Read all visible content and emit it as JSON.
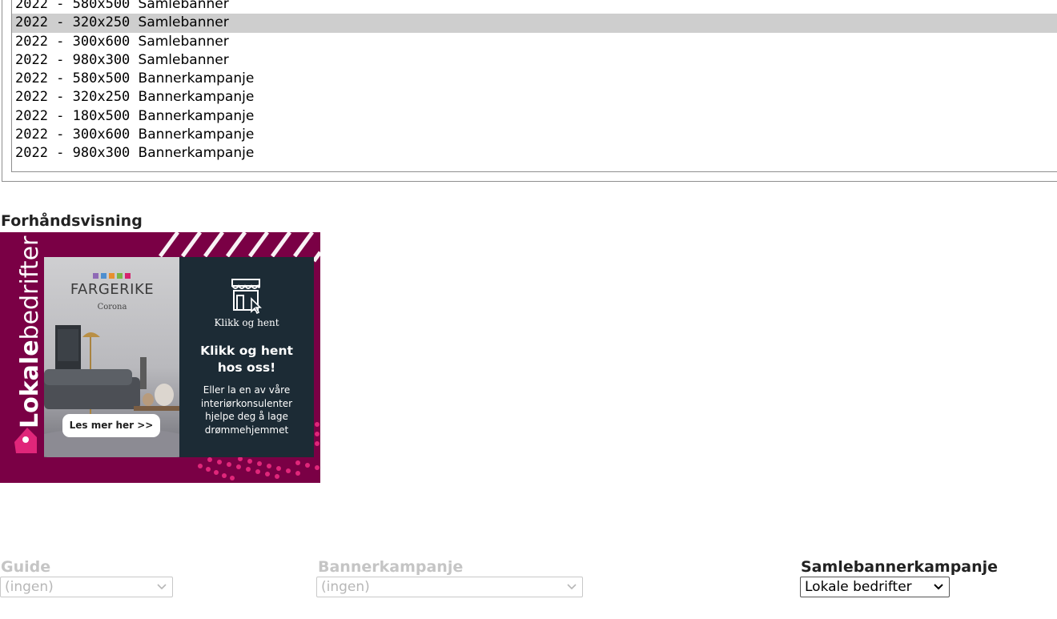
{
  "listbox": {
    "items": [
      {
        "prefix": "2022 - 580x500 ",
        "name": "Samlebanner",
        "selected": false
      },
      {
        "prefix": "2022 - 320x250 ",
        "name": "Samlebanner",
        "selected": true
      },
      {
        "prefix": "2022 - 300x600 ",
        "name": "Samlebanner",
        "selected": false
      },
      {
        "prefix": "2022 - 980x300 ",
        "name": "Samlebanner",
        "selected": false
      },
      {
        "prefix": "2022 - 580x500 ",
        "name": "Bannerkampanje",
        "selected": false
      },
      {
        "prefix": "2022 - 320x250 ",
        "name": "Bannerkampanje",
        "selected": false
      },
      {
        "prefix": "2022 - 180x500 ",
        "name": "Bannerkampanje",
        "selected": false
      },
      {
        "prefix": "2022 - 300x600 ",
        "name": "Bannerkampanje",
        "selected": false
      },
      {
        "prefix": "2022 - 980x300 ",
        "name": "Bannerkampanje",
        "selected": false
      }
    ]
  },
  "preview": {
    "title": "Forhåndsvisning",
    "banner": {
      "brand_bold": "Lokale",
      "brand_light": "bedrifter",
      "logo_text": "FARGERIKE",
      "logo_sub": "Corona",
      "cta_button": "Les mer her >>",
      "panel_small_title": "Klikk og hent",
      "panel_headline_1": "Klikk og hent",
      "panel_headline_2": "hos oss!",
      "panel_body_1": "Eller la en av våre",
      "panel_body_2": "interiørkonsulenter",
      "panel_body_3": "hjelpe deg å lage",
      "panel_body_4": "drømmehjemmet",
      "colors": {
        "background": "#7a0045",
        "panel": "#1c2b35",
        "accent_pink": "#e0267a"
      }
    }
  },
  "fields": {
    "guide": {
      "label": "Guide",
      "value": "(ingen)"
    },
    "bannerkampanje": {
      "label": "Bannerkampanje",
      "value": "(ingen)"
    },
    "samlebannerkampanje": {
      "label": "Samlebannerkampanje",
      "value": "Lokale bedrifter"
    }
  }
}
